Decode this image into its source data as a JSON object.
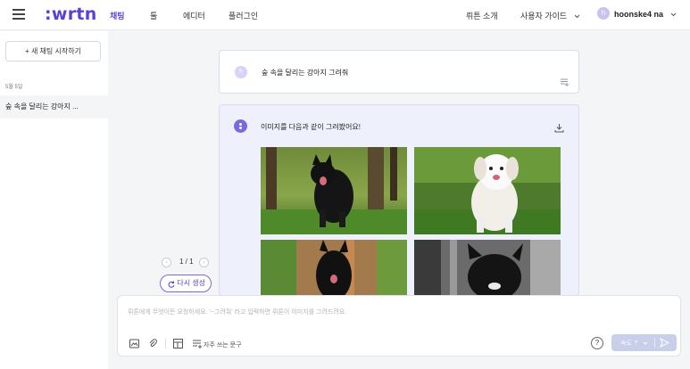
{
  "header": {
    "logo": ":wrtn",
    "nav": [
      "채팅",
      "툴",
      "에디터",
      "플러그인"
    ],
    "right_links": [
      "뤼튼 소개",
      "사용자 가이드"
    ],
    "user_initial": "h",
    "user_name": "hoonske4 na"
  },
  "sidebar": {
    "new_chat_label": "+  새 채팅 시작하기",
    "date_label": "5월 5일",
    "items": [
      {
        "label": "숲 속을 달리는 강아지 ..."
      }
    ]
  },
  "conversation": {
    "user_initial": "h",
    "user_message": "숲 속을 달리는 강아지 그려줘",
    "bot_message": "이미지를 다음과 같이 그려봤어요!",
    "images": [
      {
        "name": "black-dog-forest-1"
      },
      {
        "name": "white-dog-forest"
      },
      {
        "name": "black-dog-forest-2"
      },
      {
        "name": "black-dog-monochrome"
      }
    ],
    "pager": "1 / 1",
    "regenerate_label": "다시 생성"
  },
  "input": {
    "placeholder": "뤼튼에게 무엇이든 요청하세요.  '~그려줘' 라고 입력하면 뤼튼이 이미지를 그려드려요.",
    "frequent_phrases_label": "자주 쓰는 문구",
    "help_label": "?",
    "mode_label": "속도 ⇡"
  },
  "colors": {
    "accent": "#5b3fd9",
    "bot_card_bg": "#eef1fb",
    "send_disabled": "#c8cfe8"
  }
}
